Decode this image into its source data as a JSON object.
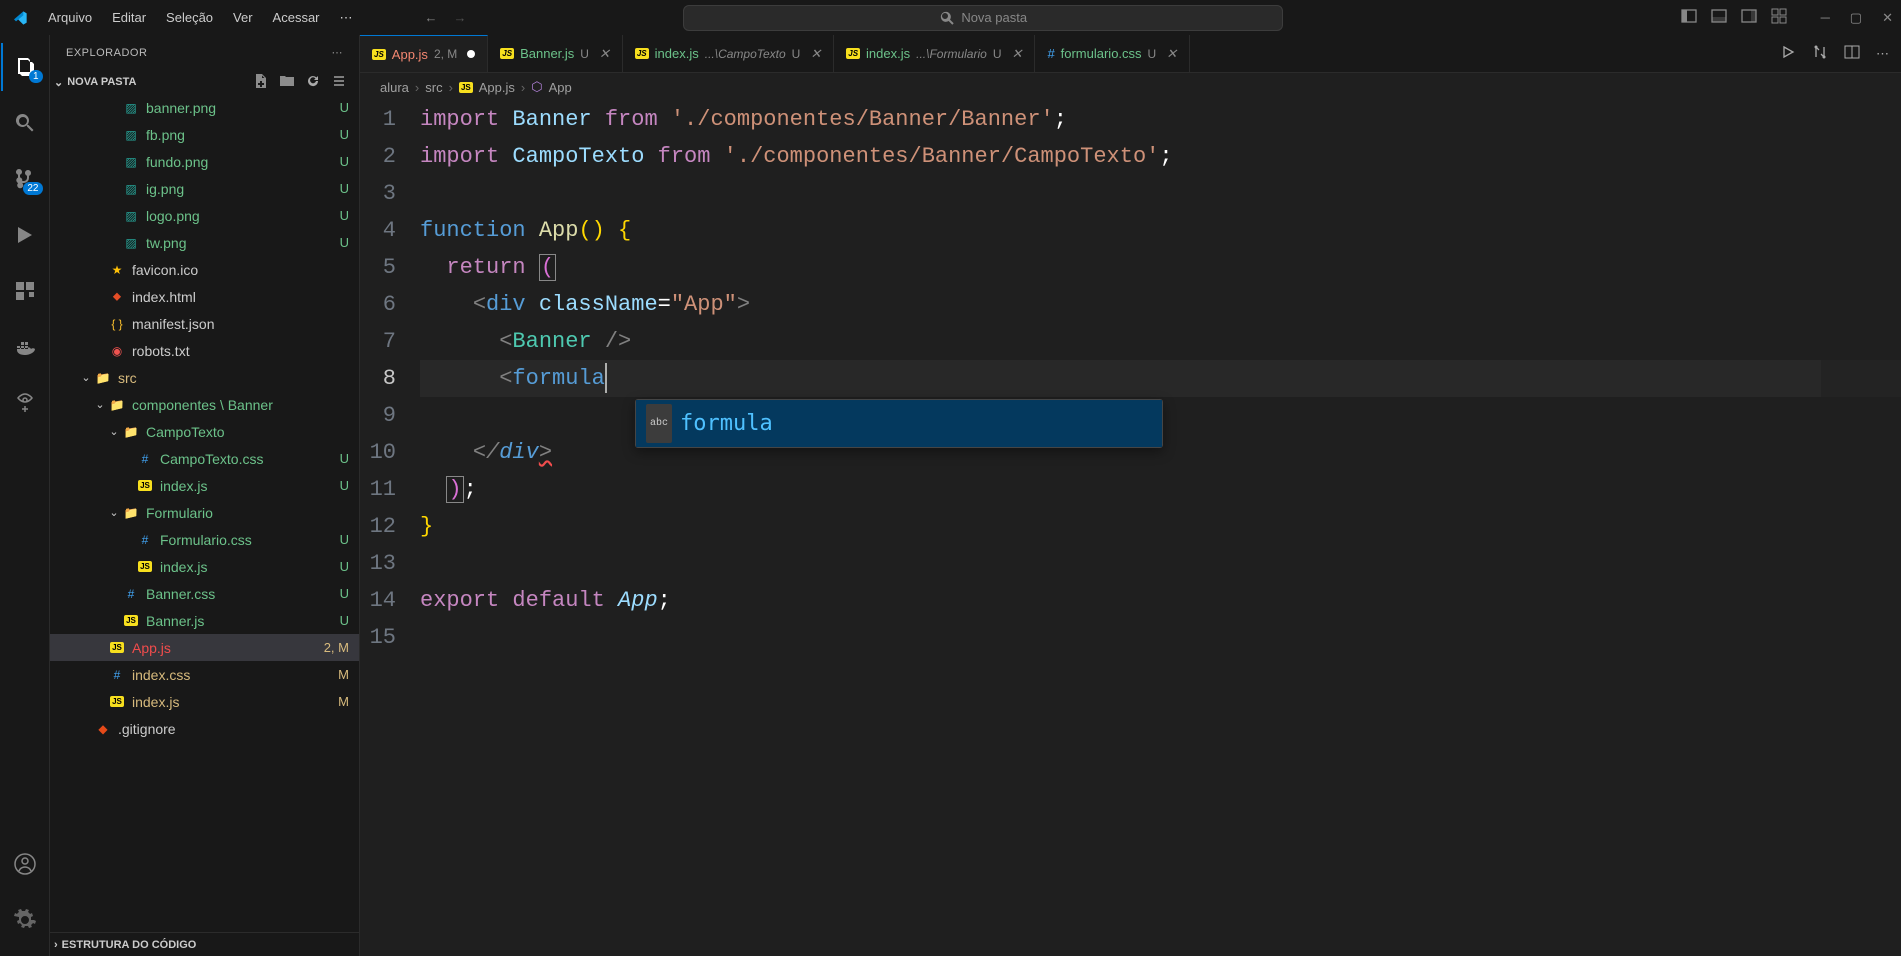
{
  "titlebar": {
    "menus": [
      "Arquivo",
      "Editar",
      "Seleção",
      "Ver",
      "Acessar"
    ],
    "search_placeholder": "Nova pasta"
  },
  "activitybar": {
    "explorer_badge": "1",
    "scm_badge": "22"
  },
  "sidebar": {
    "title": "EXPLORADOR",
    "folder_name": "NOVA PASTA",
    "outline_title": "ESTRUTURA DO CÓDIGO",
    "tree": [
      {
        "indent": 3,
        "icon": "img",
        "name": "banner.png",
        "git": "U"
      },
      {
        "indent": 3,
        "icon": "img",
        "name": "fb.png",
        "git": "U"
      },
      {
        "indent": 3,
        "icon": "img",
        "name": "fundo.png",
        "git": "U"
      },
      {
        "indent": 3,
        "icon": "img",
        "name": "ig.png",
        "git": "U"
      },
      {
        "indent": 3,
        "icon": "img",
        "name": "logo.png",
        "git": "U"
      },
      {
        "indent": 3,
        "icon": "img",
        "name": "tw.png",
        "git": "U"
      },
      {
        "indent": 2,
        "icon": "star",
        "name": "favicon.ico",
        "git": ""
      },
      {
        "indent": 2,
        "icon": "html",
        "name": "index.html",
        "git": ""
      },
      {
        "indent": 2,
        "icon": "json",
        "name": "manifest.json",
        "git": ""
      },
      {
        "indent": 2,
        "icon": "robots",
        "name": "robots.txt",
        "git": ""
      },
      {
        "indent": 1,
        "icon": "folder-src",
        "chev": "down",
        "name": "src",
        "git": "dot",
        "dotcolor": "m"
      },
      {
        "indent": 2,
        "icon": "folder",
        "chev": "down",
        "name": "componentes \\ Banner",
        "git": "dot"
      },
      {
        "indent": 3,
        "icon": "folder",
        "chev": "down",
        "name": "CampoTexto",
        "git": "dot"
      },
      {
        "indent": 4,
        "icon": "css",
        "name": "CampoTexto.css",
        "git": "U"
      },
      {
        "indent": 4,
        "icon": "js",
        "name": "index.js",
        "git": "U"
      },
      {
        "indent": 3,
        "icon": "folder",
        "chev": "down",
        "name": "Formulario",
        "git": "dot"
      },
      {
        "indent": 4,
        "icon": "css",
        "name": "Formulario.css",
        "git": "U"
      },
      {
        "indent": 4,
        "icon": "js",
        "name": "index.js",
        "git": "U"
      },
      {
        "indent": 3,
        "icon": "css",
        "name": "Banner.css",
        "git": "U"
      },
      {
        "indent": 3,
        "icon": "js",
        "name": "Banner.js",
        "git": "U"
      },
      {
        "indent": 2,
        "icon": "js",
        "name": "App.js",
        "git": "2, M",
        "active": true,
        "cls": "err"
      },
      {
        "indent": 2,
        "icon": "css",
        "name": "index.css",
        "git": "M"
      },
      {
        "indent": 2,
        "icon": "js",
        "name": "index.js",
        "git": "M"
      },
      {
        "indent": 1,
        "icon": "git",
        "name": ".gitignore",
        "git": ""
      }
    ]
  },
  "tabs": [
    {
      "icon": "js",
      "name": "App.js",
      "suffix": "2, M",
      "cls": "err",
      "active": true,
      "dirty": true
    },
    {
      "icon": "js",
      "name": "Banner.js",
      "suffix": "U",
      "cls": "git-u"
    },
    {
      "icon": "js",
      "name": "index.js",
      "path": "...\\CampoTexto",
      "suffix": "U",
      "cls": "git-u"
    },
    {
      "icon": "js",
      "name": "index.js",
      "path": "...\\Formulario",
      "suffix": "U",
      "cls": "git-u"
    },
    {
      "icon": "css",
      "name": "formulario.css",
      "suffix": "U",
      "cls": "git-u"
    }
  ],
  "breadcrumb": [
    "alura",
    "src",
    "App.js",
    "App"
  ],
  "editor": {
    "suggestion": "formula",
    "lines": 15,
    "current_line": 8
  },
  "code": {
    "l1_import": "import",
    "l1_banner": "Banner",
    "l1_from": "from",
    "l1_path": "'./componentes/Banner/Banner'",
    "l2_import": "import",
    "l2_campo": "CampoTexto",
    "l2_from": "from",
    "l2_path": "'./componentes/Banner/CampoTexto'",
    "l4_function": "function",
    "l4_app": "App",
    "l5_return": "return",
    "l6_div": "div",
    "l6_classname": "className",
    "l6_val": "\"App\"",
    "l7_banner": "Banner",
    "l8_formula": "formula",
    "l10_div": "div",
    "l14_export": "export",
    "l14_default": "default",
    "l14_app": "App"
  }
}
